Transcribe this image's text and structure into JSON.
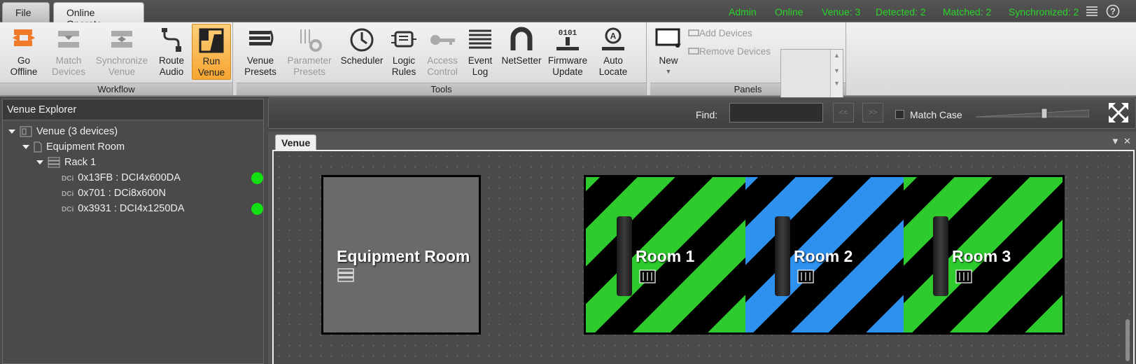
{
  "tabs": {
    "file": "File",
    "online": "Online Operate"
  },
  "status": {
    "user": "Admin",
    "mode": "Online",
    "venue": "Venue: 3",
    "detected": "Detected: 2",
    "matched": "Matched: 2",
    "synchronized": "Synchronized: 2"
  },
  "ribbon": {
    "workflow": {
      "label": "Workflow",
      "go_offline": [
        "Go",
        "Offline"
      ],
      "match_devices": [
        "Match",
        "Devices"
      ],
      "synchronize_venue": [
        "Synchronize",
        "Venue"
      ],
      "route_audio": [
        "Route",
        "Audio"
      ],
      "run_venue": [
        "Run",
        "Venue"
      ]
    },
    "tools": {
      "label": "Tools",
      "venue_presets": [
        "Venue",
        "Presets"
      ],
      "parameter_presets": [
        "Parameter",
        "Presets"
      ],
      "scheduler": [
        "Scheduler",
        ""
      ],
      "logic_rules": [
        "Logic",
        "Rules"
      ],
      "access_control": [
        "Access",
        "Control"
      ],
      "event_log": [
        "Event",
        "Log"
      ],
      "netsetter": [
        "NetSetter",
        ""
      ],
      "firmware_update": [
        "Firmware",
        "Update"
      ],
      "auto_locate": [
        "Auto",
        "Locate"
      ]
    },
    "panels": {
      "label": "Panels",
      "new": "New",
      "add_devices": "Add Devices",
      "remove_devices": "Remove Devices"
    }
  },
  "explorer": {
    "title": "Venue Explorer",
    "venue": "Venue (3 devices)",
    "room": "Equipment Room",
    "rack": "Rack 1",
    "device_prefix": "DCi",
    "devices": [
      {
        "label": "0x13FB : DCI4x600DA",
        "online": true
      },
      {
        "label": "0x701 : DCi8x600N",
        "online": false
      },
      {
        "label": "0x3931 : DCI4x1250DA",
        "online": true
      }
    ]
  },
  "find": {
    "label": "Find:",
    "value": "",
    "prev": "<<",
    "next": ">>",
    "match_case": "Match Case"
  },
  "doc_tab": "Venue",
  "canvas": {
    "equipment_room": "Equipment Room",
    "rooms": [
      {
        "name": "Room 1",
        "color": "#2dcb2d"
      },
      {
        "name": "Room 2",
        "color": "#2d91f0"
      },
      {
        "name": "Room 3",
        "color": "#2dcb2d"
      }
    ]
  },
  "colors": {
    "status_green": "#2ad42a",
    "online_dot": "#12e012",
    "accent_orange": "#f6a531"
  }
}
